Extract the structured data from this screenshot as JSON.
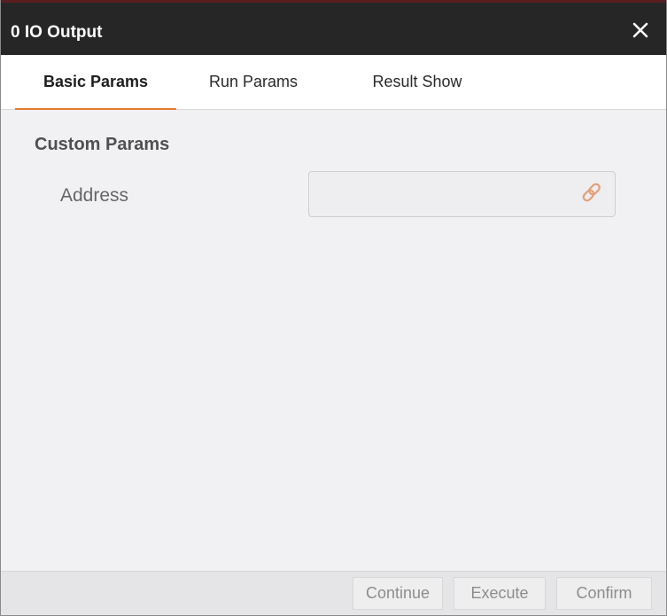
{
  "window": {
    "title": "0 IO Output",
    "close_icon": "close-icon"
  },
  "tabs": [
    {
      "label": "Basic Params",
      "active": true
    },
    {
      "label": "Run Params",
      "active": false
    },
    {
      "label": "Result Show",
      "active": false
    }
  ],
  "content": {
    "section_title": "Custom Params",
    "address": {
      "label": "Address",
      "value": "",
      "icon": "link-icon"
    }
  },
  "footer": {
    "continue_label": "Continue",
    "execute_label": "Execute",
    "confirm_label": "Confirm"
  },
  "colors": {
    "titlebar": "#262626",
    "accent": "#e8792b",
    "background": "#f1f1f3"
  }
}
